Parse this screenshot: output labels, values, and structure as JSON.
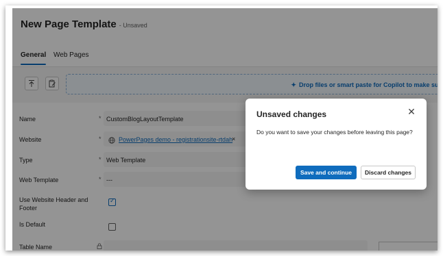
{
  "header": {
    "title": "New Page Template",
    "status": "- Unsaved"
  },
  "tabs": [
    {
      "label": "General",
      "active": true
    },
    {
      "label": "Web Pages",
      "active": false
    }
  ],
  "toolbar": {
    "upload_icon": "arrow-up-to-line-icon",
    "paste_icon": "clipboard-edit-icon"
  },
  "dropzone": {
    "icon": "sparkle-icon",
    "text": "Drop files or smart paste for Copilot to make sug"
  },
  "form": {
    "name": {
      "label": "Name",
      "required": "*",
      "value": "CustomBlogLayoutTemplate"
    },
    "website": {
      "label": "Website",
      "required": "*",
      "value": "PowerPages demo - registrationsite-rtdah",
      "remove": "×"
    },
    "type": {
      "label": "Type",
      "required": "*",
      "value": "Web Template"
    },
    "web_template": {
      "label": "Web Template",
      "required": "*",
      "value": "---"
    },
    "use_header_footer": {
      "label_line1": "Use Website Header and",
      "label_line2": "Footer",
      "checked": true
    },
    "is_default": {
      "label": "Is Default",
      "checked": false
    },
    "table_name": {
      "label": "Table Name",
      "icon": "lock-icon"
    }
  },
  "dialog": {
    "title": "Unsaved changes",
    "message": "Do you want to save your changes before leaving this page?",
    "close_icon": "close-icon",
    "primary_label": "Save and continue",
    "secondary_label": "Discard changes"
  },
  "colors": {
    "accent": "#0f6cbd",
    "overlay": "rgba(0,0,0,0.42)"
  }
}
